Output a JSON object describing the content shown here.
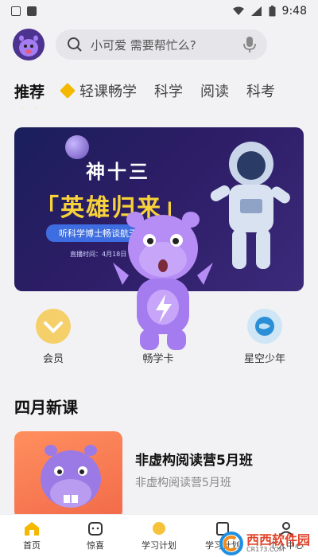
{
  "status_bar": {
    "time": "9:48"
  },
  "search": {
    "placeholder": "小可爱 需要帮忙么?"
  },
  "tabs": [
    {
      "label": "推荐",
      "active": true
    },
    {
      "label": "轻课畅学",
      "active": false
    },
    {
      "label": "科学",
      "active": false
    },
    {
      "label": "阅读",
      "active": false
    },
    {
      "label": "科考",
      "active": false
    }
  ],
  "banner": {
    "line1": "神十三",
    "line2": "「英雄归来」",
    "line3": "听科学博士畅谈航天",
    "line4": "直播时间：4月18日"
  },
  "quick_icons": [
    {
      "label": "会员",
      "color": "#f5c23a"
    },
    {
      "label": "畅学卡",
      "color": "#9b6df0"
    },
    {
      "label": "星空少年",
      "color": "#2a8fd6"
    }
  ],
  "section": {
    "title": "四月新课"
  },
  "course": {
    "title": "非虚构阅读营5月班",
    "subtitle": "非虚构阅读营5月班"
  },
  "tabbar": [
    {
      "label": "首页",
      "icon": "home-icon"
    },
    {
      "label": "惊喜",
      "icon": "gift-icon"
    },
    {
      "label": "学习计划",
      "icon": "plan-icon"
    },
    {
      "label": "学习计划",
      "icon": "plan-icon"
    },
    {
      "label": "个人中心",
      "icon": "user-icon"
    }
  ],
  "watermark": {
    "brand": "西西软件园",
    "url": "CR173.COM"
  },
  "colors": {
    "accent": "#f5b800",
    "purple": "#9b6df0"
  }
}
